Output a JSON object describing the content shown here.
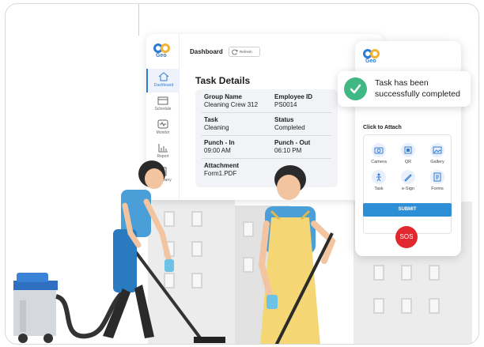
{
  "dashboard": {
    "logo_text": "Geo",
    "title": "Dashboard",
    "refresh_label": "Refresh",
    "nav": [
      {
        "label": "Dashboard",
        "icon": "home-icon",
        "active": true
      },
      {
        "label": "Schedule",
        "icon": "calendar-icon"
      },
      {
        "label": "Monitor",
        "icon": "monitor-icon"
      },
      {
        "label": "Report",
        "icon": "bar-chart-icon"
      },
      {
        "label": "Company",
        "icon": "building-icon"
      }
    ]
  },
  "task": {
    "heading": "Task Details",
    "fields": [
      {
        "key": "Group Name",
        "value": "Cleaning Crew 312"
      },
      {
        "key": "Employee ID",
        "value": "PS0014"
      },
      {
        "key": "Task",
        "value": "Cleaning"
      },
      {
        "key": "Status",
        "value": "Completed"
      },
      {
        "key": "Punch - In",
        "value": "09:00 AM"
      },
      {
        "key": "Punch - Out",
        "value": "06:10 PM"
      },
      {
        "key": "Attachment",
        "value": "Form1.PDF"
      }
    ]
  },
  "phone": {
    "logo_text": "Geo",
    "attach_title": "Click to Attach",
    "attach_items": [
      {
        "label": "Camera",
        "icon": "camera-icon"
      },
      {
        "label": "QR",
        "icon": "qr-icon"
      },
      {
        "label": "Gallery",
        "icon": "gallery-icon"
      },
      {
        "label": "Task",
        "icon": "task-icon"
      },
      {
        "label": "e-Sign",
        "icon": "pen-icon"
      },
      {
        "label": "Forms",
        "icon": "forms-icon"
      }
    ],
    "submit_label": "SUBMIT",
    "sos_label": "SOS"
  },
  "toast": {
    "message": "Task has been successfully completed"
  },
  "colors": {
    "accent": "#2e8fd6",
    "success": "#41b883",
    "danger": "#e0282e",
    "logo_blue": "#2e7bd6",
    "logo_yellow": "#f2b233"
  }
}
